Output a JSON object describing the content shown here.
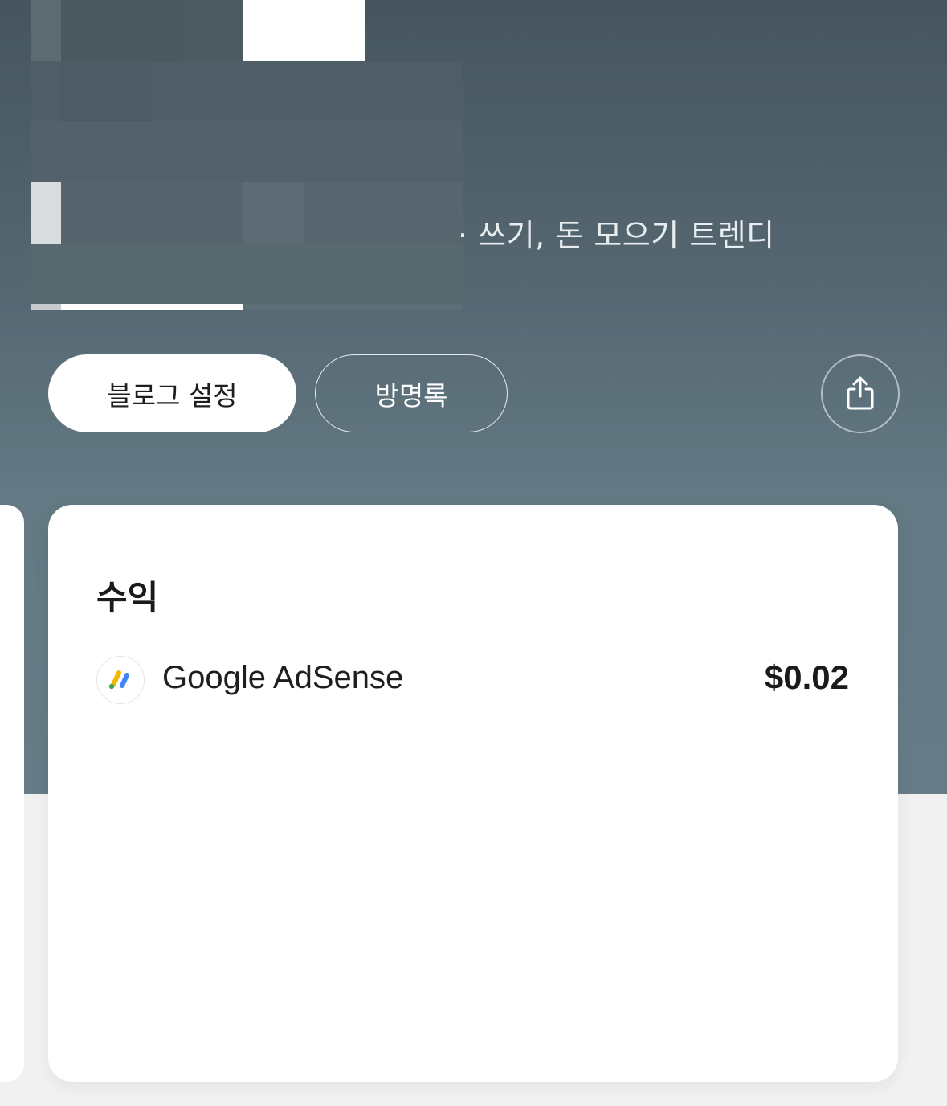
{
  "header": {
    "subtitle_visible": "· 쓰기, 돈 모으기 트렌디",
    "colors": {
      "gradient_top": "#46555d",
      "gradient_bottom": "#667b86"
    }
  },
  "actions": {
    "settings_label": "블로그 설정",
    "guestbook_label": "방명록",
    "share_icon": "share-icon"
  },
  "revenue": {
    "title": "수익",
    "items": [
      {
        "icon": "google-adsense-icon",
        "name": "Google AdSense",
        "amount": "$0.02"
      }
    ]
  }
}
